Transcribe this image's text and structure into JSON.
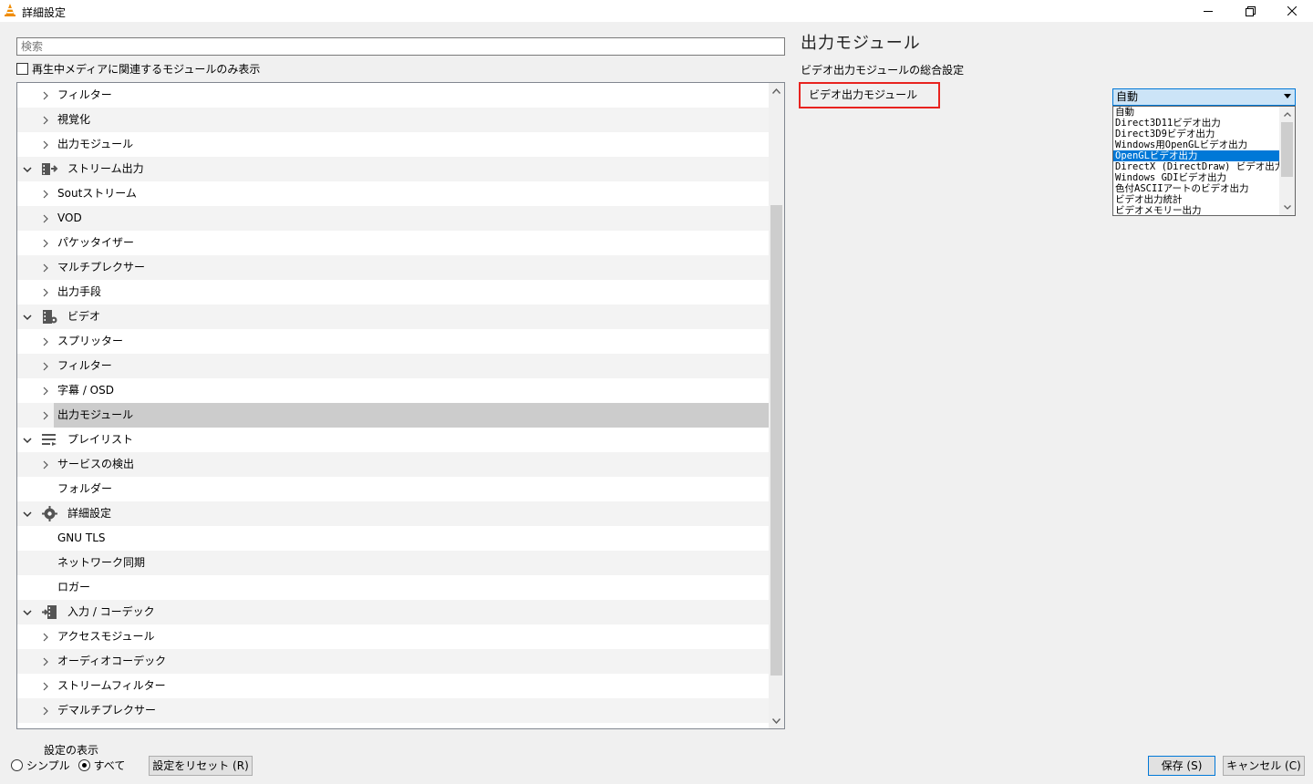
{
  "window": {
    "title": "詳細設定"
  },
  "search": {
    "placeholder": "検索"
  },
  "filter_checkbox": {
    "label": "再生中メディアに関連するモジュールのみ表示",
    "checked": false
  },
  "tree": {
    "rows": [
      {
        "label": "フィルター",
        "level": 2,
        "expander": "right"
      },
      {
        "label": "視覚化",
        "level": 2,
        "expander": "right"
      },
      {
        "label": "出力モジュール",
        "level": 2,
        "expander": "right"
      },
      {
        "label": "ストリーム出力",
        "level": 1,
        "expander": "down",
        "icon": "stream-output-icon"
      },
      {
        "label": "Soutストリーム",
        "level": 2,
        "expander": "right"
      },
      {
        "label": "VOD",
        "level": 2,
        "expander": "right"
      },
      {
        "label": "パケッタイザー",
        "level": 2,
        "expander": "right"
      },
      {
        "label": "マルチプレクサー",
        "level": 2,
        "expander": "right"
      },
      {
        "label": "出力手段",
        "level": 2,
        "expander": "right"
      },
      {
        "label": "ビデオ",
        "level": 1,
        "expander": "down",
        "icon": "video-icon"
      },
      {
        "label": "スプリッター",
        "level": 2,
        "expander": "right"
      },
      {
        "label": "フィルター",
        "level": 2,
        "expander": "right"
      },
      {
        "label": "字幕 / OSD",
        "level": 2,
        "expander": "right"
      },
      {
        "label": "出力モジュール",
        "level": 2,
        "expander": "right",
        "selected": true
      },
      {
        "label": "プレイリスト",
        "level": 1,
        "expander": "down",
        "icon": "playlist-icon"
      },
      {
        "label": "サービスの検出",
        "level": 2,
        "expander": "right"
      },
      {
        "label": "フォルダー",
        "level": 2,
        "expander": "none"
      },
      {
        "label": "詳細設定",
        "level": 1,
        "expander": "down",
        "icon": "advanced-settings-icon"
      },
      {
        "label": "GNU TLS",
        "level": 2,
        "expander": "none"
      },
      {
        "label": "ネットワーク同期",
        "level": 2,
        "expander": "none"
      },
      {
        "label": "ロガー",
        "level": 2,
        "expander": "none"
      },
      {
        "label": "入力 / コーデック",
        "level": 1,
        "expander": "down",
        "icon": "input-codec-icon"
      },
      {
        "label": "アクセスモジュール",
        "level": 2,
        "expander": "right"
      },
      {
        "label": "オーディオコーデック",
        "level": 2,
        "expander": "right"
      },
      {
        "label": "ストリームフィルター",
        "level": 2,
        "expander": "right"
      },
      {
        "label": "デマルチプレクサー",
        "level": 2,
        "expander": "right"
      }
    ]
  },
  "panel": {
    "title": "出力モジュール",
    "section_title": "ビデオ出力モジュールの総合設定",
    "setting_label": "ビデオ出力モジュール",
    "combo_value": "自動",
    "options": [
      "自動",
      "Direct3D11ビデオ出力",
      "Direct3D9ビデオ出力",
      "Windows用OpenGLビデオ出力",
      "OpenGLビデオ出力",
      "DirectX (DirectDraw) ビデオ出力",
      "Windows GDIビデオ出力",
      "色付ASCIIアートのビデオ出力",
      "ビデオ出力統計",
      "ビデオメモリー出力"
    ],
    "selected_option_index": 4
  },
  "footer": {
    "view_label": "設定の表示",
    "radio_simple": "シンプル",
    "radio_all": "すべて",
    "reset_button": "設定をリセット (R)",
    "save_button": "保存 (S)",
    "cancel_button": "キャンセル (C)"
  },
  "colors": {
    "accent": "#0078d7",
    "highlight_box": "#e8231f",
    "selected_row": "#cccccc"
  }
}
